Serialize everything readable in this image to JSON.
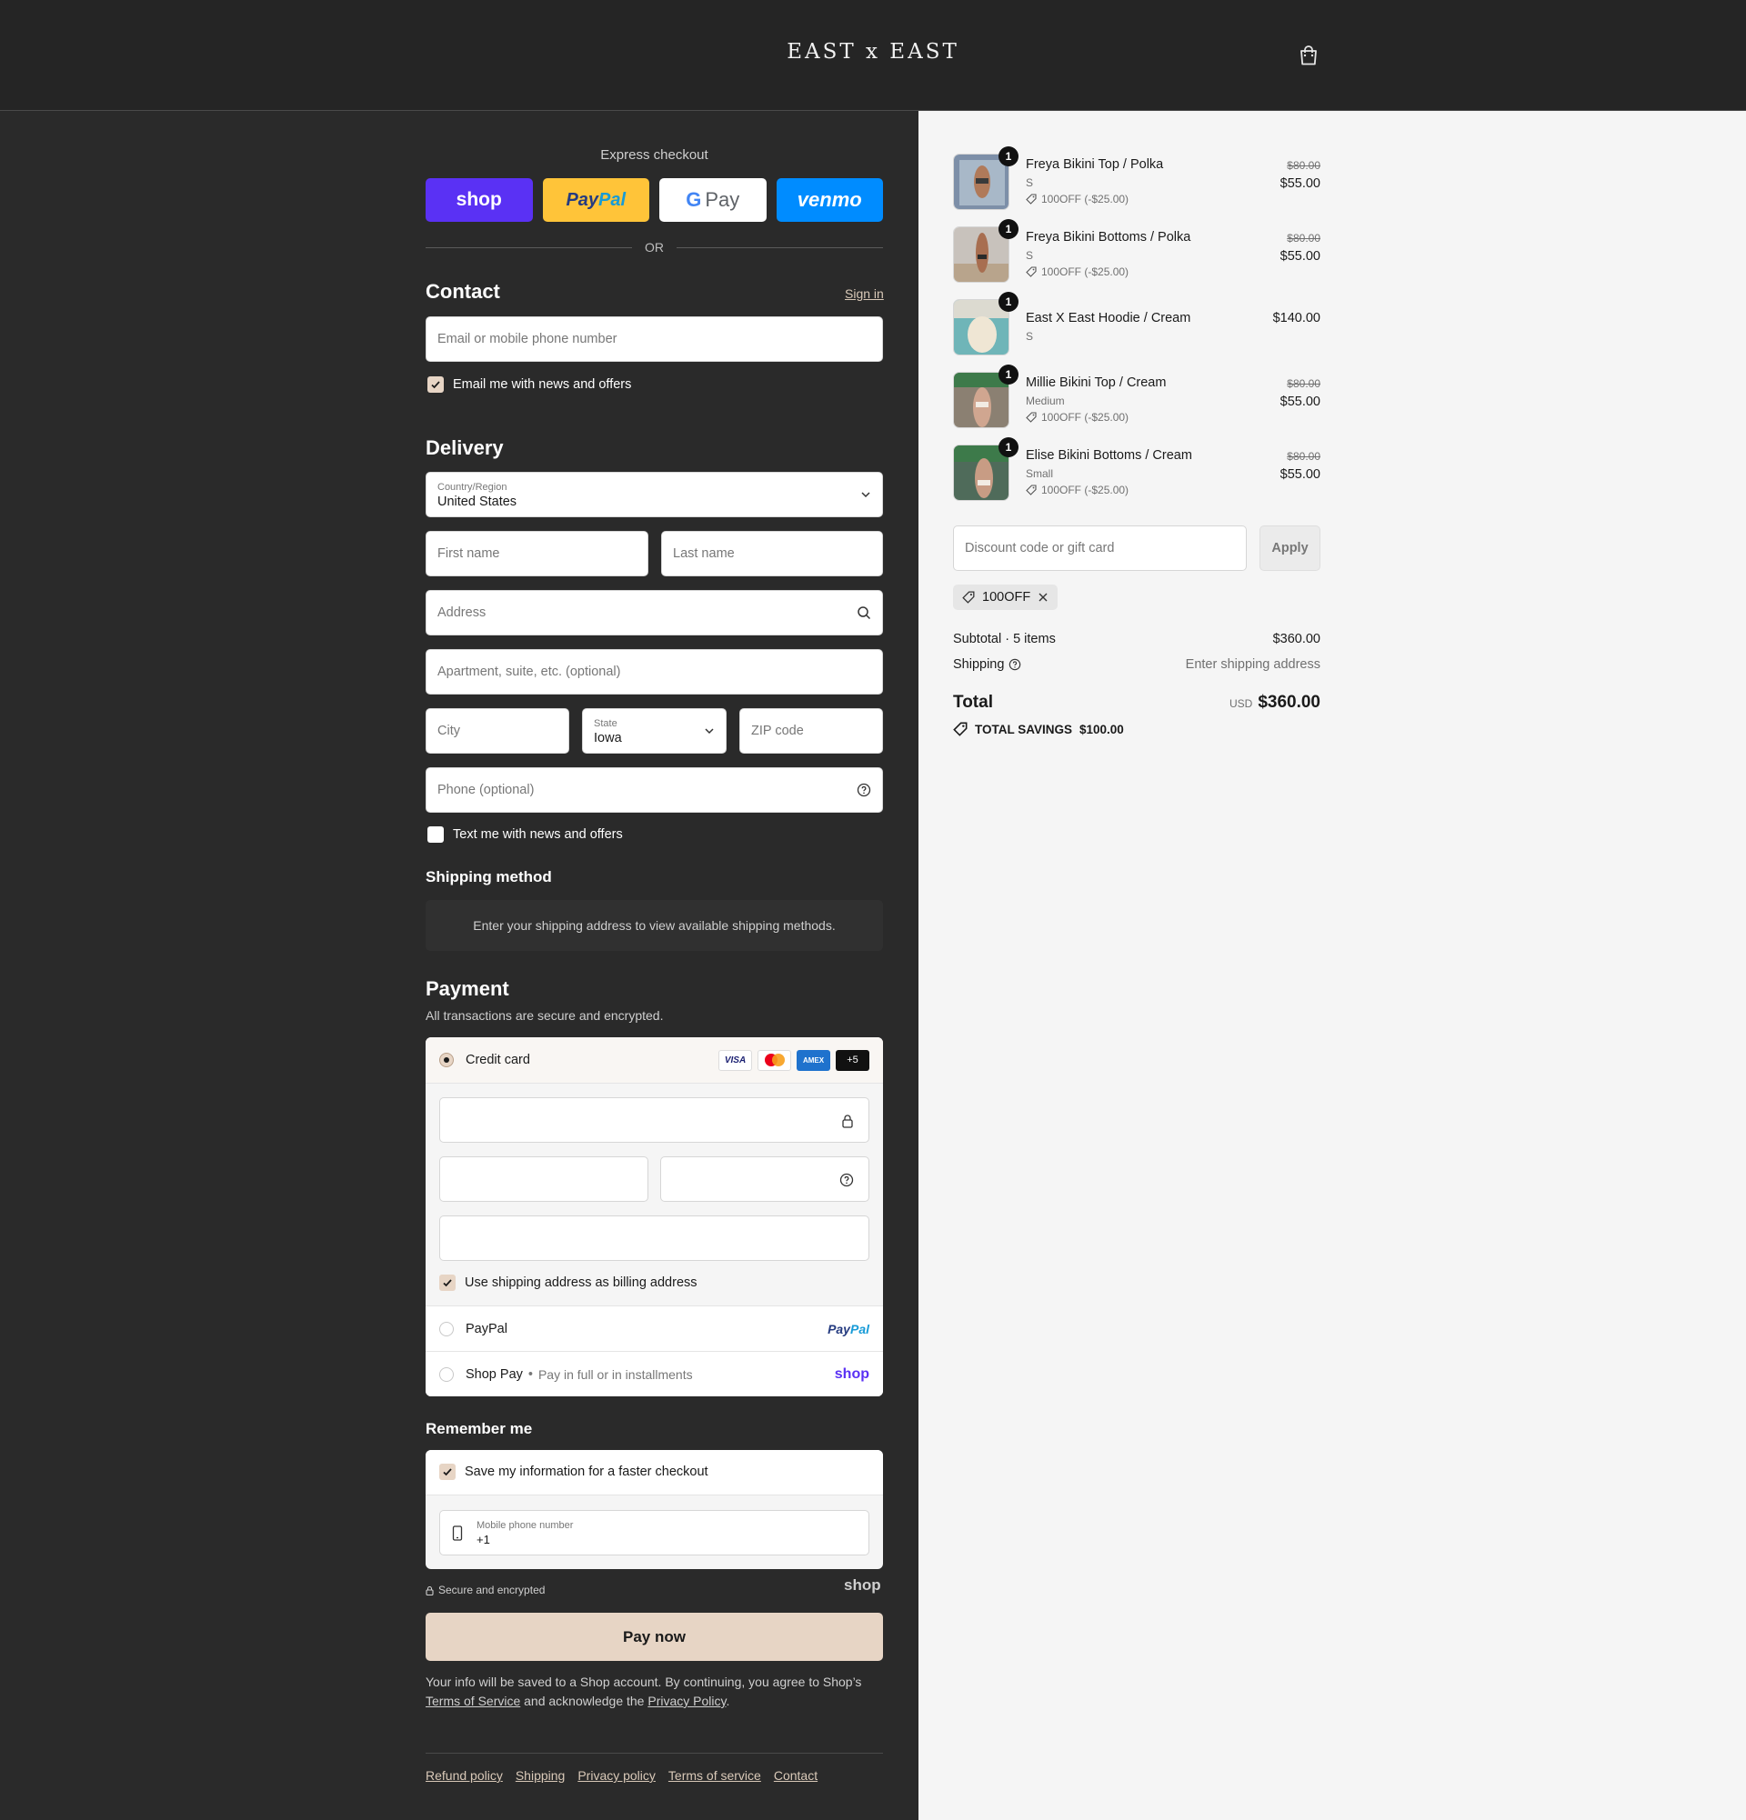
{
  "header": {
    "logo": "EAST x EAST",
    "cart_icon": "shopping-bag-icon"
  },
  "express": {
    "label": "Express checkout",
    "buttons": [
      "shop",
      "PayPal",
      "G Pay",
      "venmo"
    ],
    "colors": {
      "shop": "#5a31f4",
      "paypal": "#ffc439",
      "gpay": "#ffffff",
      "venmo": "#008cff"
    },
    "or_label": "OR"
  },
  "contact": {
    "title": "Contact",
    "sign_in": "Sign in",
    "email_placeholder": "Email or mobile phone number",
    "email_news_label": "Email me with news and offers",
    "email_news_checked": true
  },
  "delivery": {
    "title": "Delivery",
    "country_label": "Country/Region",
    "country_value": "United States",
    "first_name_placeholder": "First name",
    "last_name_placeholder": "Last name",
    "address_placeholder": "Address",
    "apartment_placeholder": "Apartment, suite, etc. (optional)",
    "city_placeholder": "City",
    "state_label": "State",
    "state_value": "Iowa",
    "zip_placeholder": "ZIP code",
    "phone_placeholder": "Phone (optional)",
    "text_news_label": "Text me with news and offers",
    "text_news_checked": false
  },
  "shipping_method": {
    "title": "Shipping method",
    "info": "Enter your shipping address to view available shipping methods."
  },
  "payment": {
    "title": "Payment",
    "subtitle": "All transactions are secure and encrypted.",
    "credit_card_label": "Credit card",
    "card_logos": [
      "VISA",
      "Mastercard",
      "AMEX",
      "+5"
    ],
    "billing_label": "Use shipping address as billing address",
    "billing_checked": true,
    "paypal_label": "PayPal",
    "paypal_logo": "PayPal",
    "shop_pay_label": "Shop Pay",
    "shop_pay_sub": "Pay in full or in installments",
    "shop_logo": "shop"
  },
  "remember": {
    "title": "Remember me",
    "save_label": "Save my information for a faster checkout",
    "save_checked": true,
    "phone_label": "Mobile phone number",
    "phone_value": "+1"
  },
  "secure": {
    "label": "Secure and encrypted",
    "shop_logo": "shop"
  },
  "pay_now": "Pay now",
  "legal": {
    "text1": "Your info will be saved to a Shop account. By continuing, you agree to Shop’s",
    "terms": "Terms of Service",
    "text2": "and acknowledge the",
    "privacy": "Privacy Policy",
    "text3": "."
  },
  "footer_links": [
    "Refund policy",
    "Shipping",
    "Privacy policy",
    "Terms of service",
    "Contact"
  ],
  "order": {
    "items": [
      {
        "qty": "1",
        "name": "Freya Bikini Top / Polka",
        "variant": "S",
        "discount": "100OFF (-$25.00)",
        "old_price": "$80.00",
        "price": "$55.00"
      },
      {
        "qty": "1",
        "name": "Freya Bikini Bottoms / Polka",
        "variant": "S",
        "discount": "100OFF (-$25.00)",
        "old_price": "$80.00",
        "price": "$55.00"
      },
      {
        "qty": "1",
        "name": "East X East Hoodie / Cream",
        "variant": "S",
        "discount": "",
        "old_price": "",
        "price": "$140.00"
      },
      {
        "qty": "1",
        "name": "Millie Bikini Top / Cream",
        "variant": "Medium",
        "discount": "100OFF (-$25.00)",
        "old_price": "$80.00",
        "price": "$55.00"
      },
      {
        "qty": "1",
        "name": "Elise Bikini Bottoms / Cream",
        "variant": "Small",
        "discount": "100OFF (-$25.00)",
        "old_price": "$80.00",
        "price": "$55.00"
      }
    ],
    "discount_placeholder": "Discount code or gift card",
    "apply_label": "Apply",
    "applied_code": "100OFF",
    "subtotal_label": "Subtotal · 5 items",
    "subtotal_value": "$360.00",
    "shipping_label": "Shipping",
    "shipping_value": "Enter shipping address",
    "total_label": "Total",
    "currency": "USD",
    "total_value": "$360.00",
    "savings_label": "TOTAL SAVINGS",
    "savings_value": "$100.00"
  }
}
